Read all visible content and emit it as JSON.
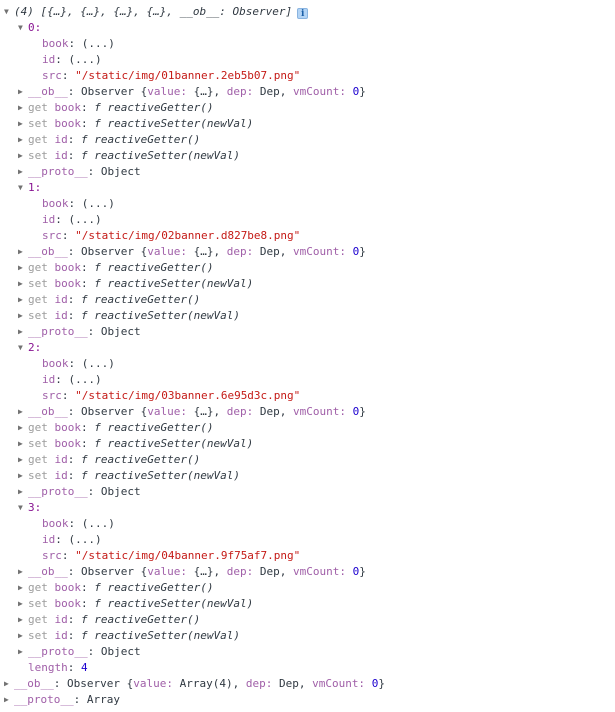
{
  "console": {
    "summary": {
      "triangle": "open",
      "count_label": "(4)",
      "preview": "[{…}, {…}, {…}, {…}, __ob__: Observer]",
      "info_icon": "info-icon",
      "info_glyph": "i"
    },
    "tokens": {
      "colon": ": ",
      "ellipsis_value": "(...)",
      "observer_ctor": "Observer ",
      "brace_open": "{",
      "brace_close": "}",
      "comma": ", ",
      "key_value": "value: ",
      "key_dep": "dep: ",
      "key_vmcount": "vmCount: ",
      "val_obj_short": "{…}",
      "val_dep": "Dep",
      "val_vmcount": "0",
      "val_array4": "Array(4)",
      "get_kw": "get ",
      "set_kw": "set ",
      "fn_symbol": "f ",
      "getter_sig": "reactiveGetter()",
      "setter_sig": "reactiveSetter(newVal)",
      "proto_key": "__proto__",
      "proto_object": "Object",
      "proto_array": "Array",
      "ob_key": "__ob__",
      "length_key": "length",
      "length_value": "4",
      "key_book": "book",
      "key_id": "id",
      "key_src": "src"
    },
    "items": [
      {
        "index_label": "0:",
        "triangle": "open",
        "src_value": "\"/static/img/01banner.2eb5b07.png\""
      },
      {
        "index_label": "1:",
        "triangle": "open",
        "src_value": "\"/static/img/02banner.d827be8.png\""
      },
      {
        "index_label": "2:",
        "triangle": "open",
        "src_value": "\"/static/img/03banner.6e95d3c.png\""
      },
      {
        "index_label": "3:",
        "triangle": "open",
        "src_value": "\"/static/img/04banner.9f75af7.png\""
      }
    ],
    "colors": {
      "background": "#ffffff",
      "text": "#303942",
      "property_key": "#881391",
      "property_key_dim": "#a05fa8",
      "string": "#c41a16",
      "number": "#1c00cf",
      "dim": "#9c9c9c",
      "triangle": "#727272",
      "info_badge_bg": "#b3d4f5"
    }
  }
}
